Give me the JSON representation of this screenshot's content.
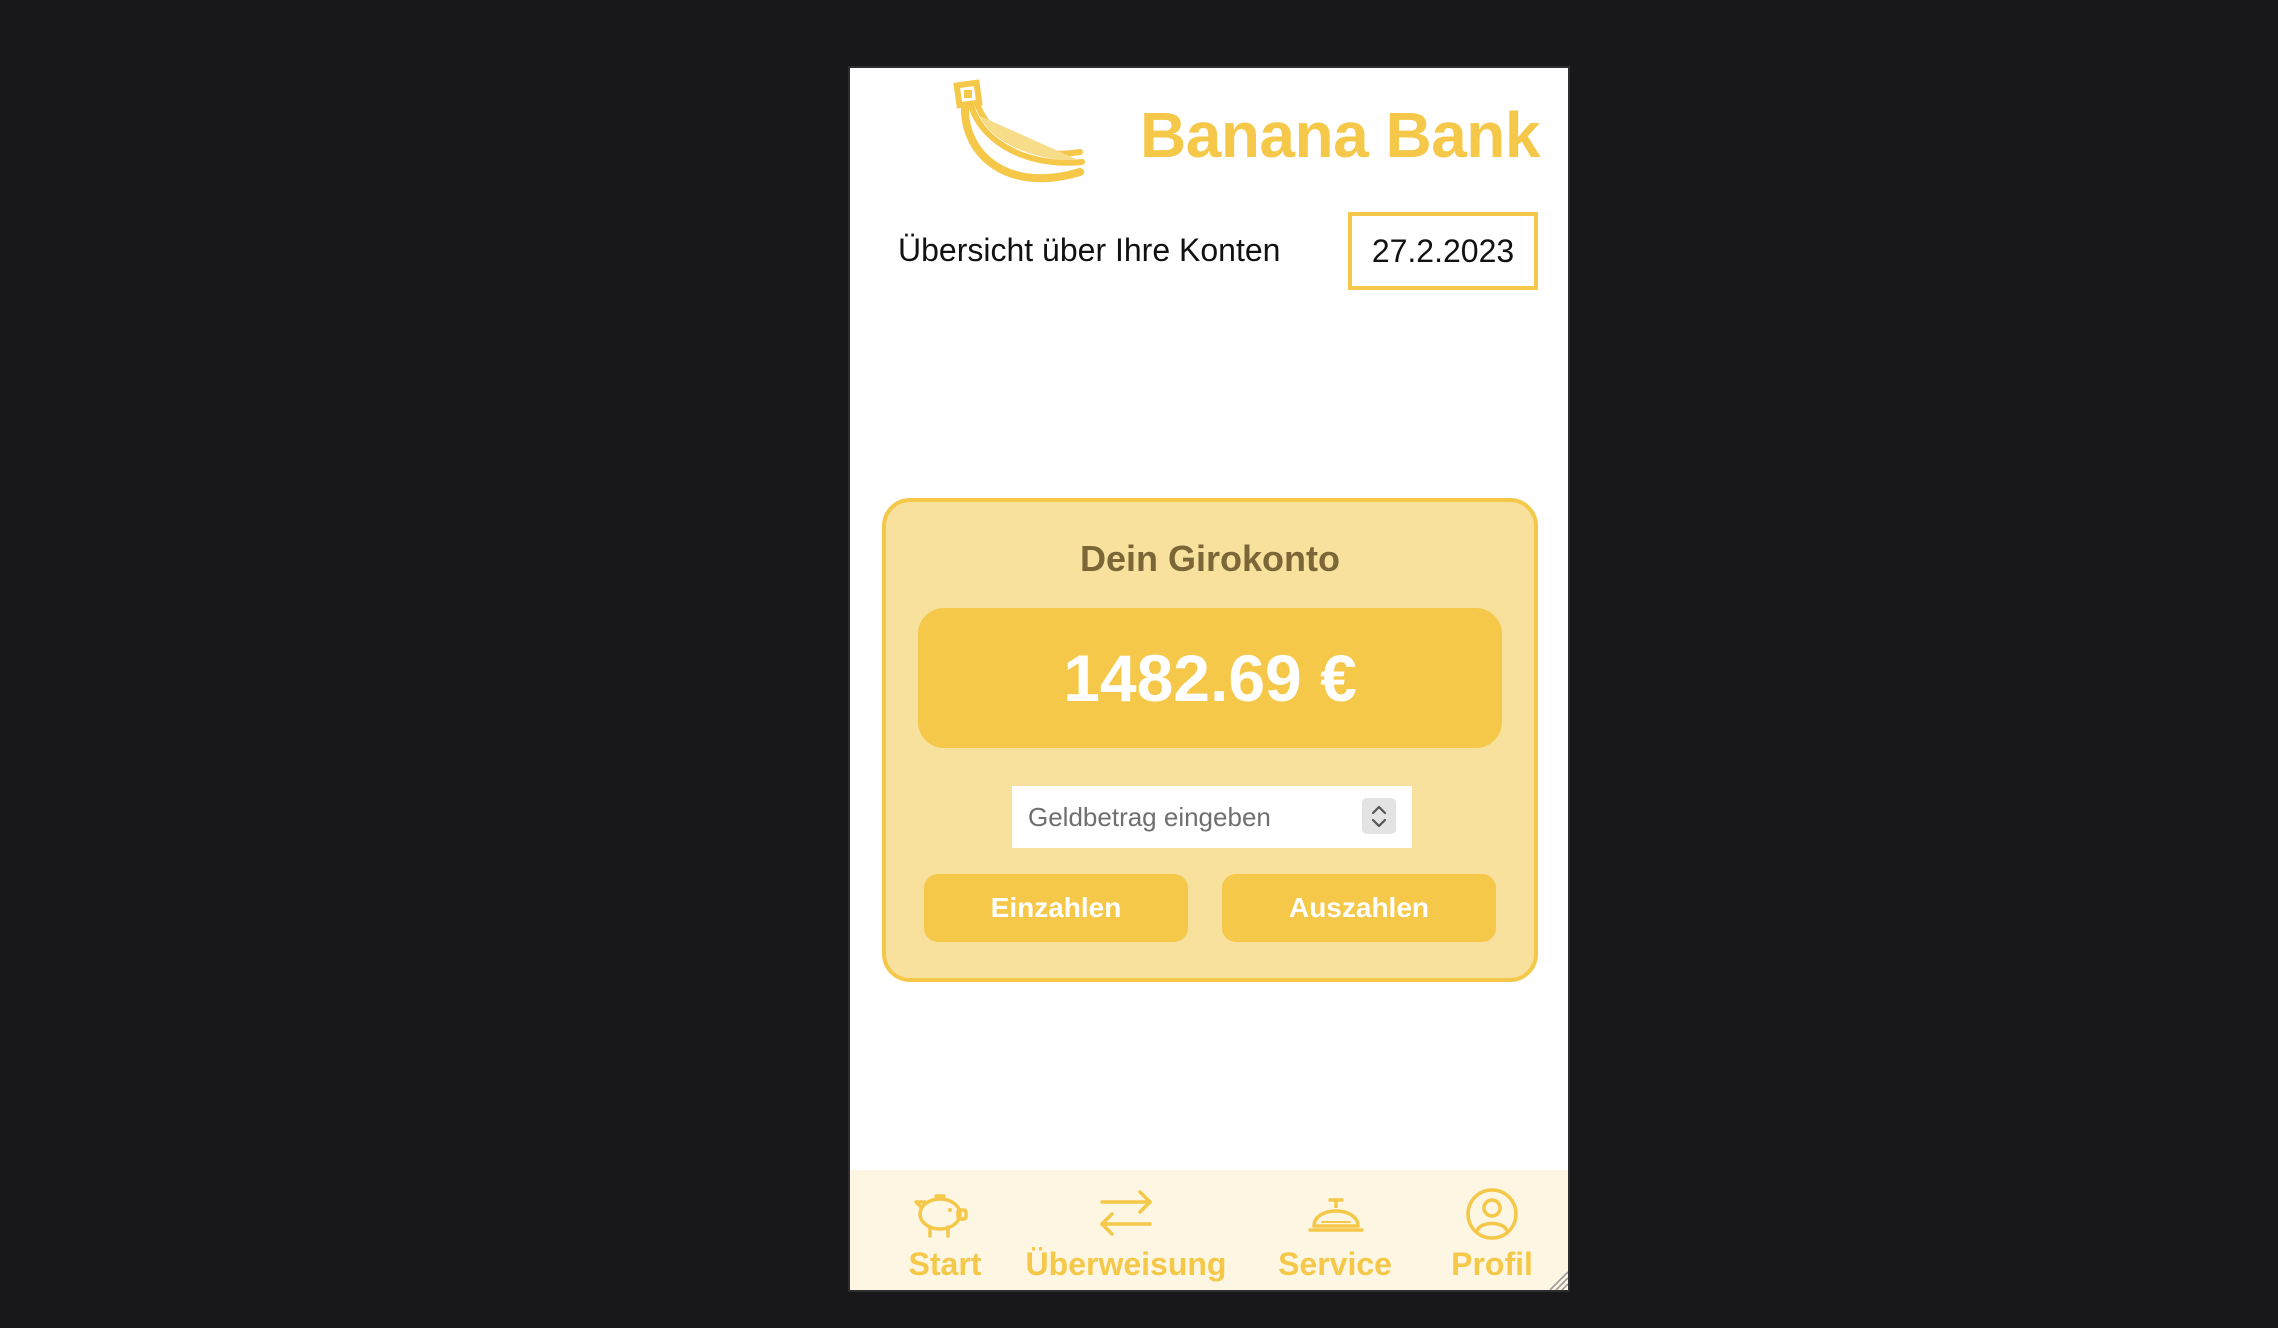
{
  "brand": {
    "name": "Banana Bank",
    "logo_icon": "banana-icon",
    "color": "#f5c84a"
  },
  "overview": {
    "label": "Übersicht über Ihre Konten",
    "date": "27.2.2023"
  },
  "account": {
    "title": "Dein Girokonto",
    "balance": "1482.69 €",
    "amount_placeholder": "Geldbetrag eingeben",
    "deposit_label": "Einzahlen",
    "withdraw_label": "Auszahlen"
  },
  "nav": {
    "items": [
      {
        "label": "Start",
        "icon": "piggy-bank-icon"
      },
      {
        "label": "Überweisung",
        "icon": "transfer-arrows-icon"
      },
      {
        "label": "Service",
        "icon": "service-bell-icon"
      },
      {
        "label": "Profil",
        "icon": "profile-icon"
      }
    ]
  },
  "colors": {
    "accent": "#f5c84a",
    "card_background": "#f7e19d",
    "card_title": "#7a6636",
    "nav_background": "#fcf6e2",
    "page_background": "#18181a"
  }
}
